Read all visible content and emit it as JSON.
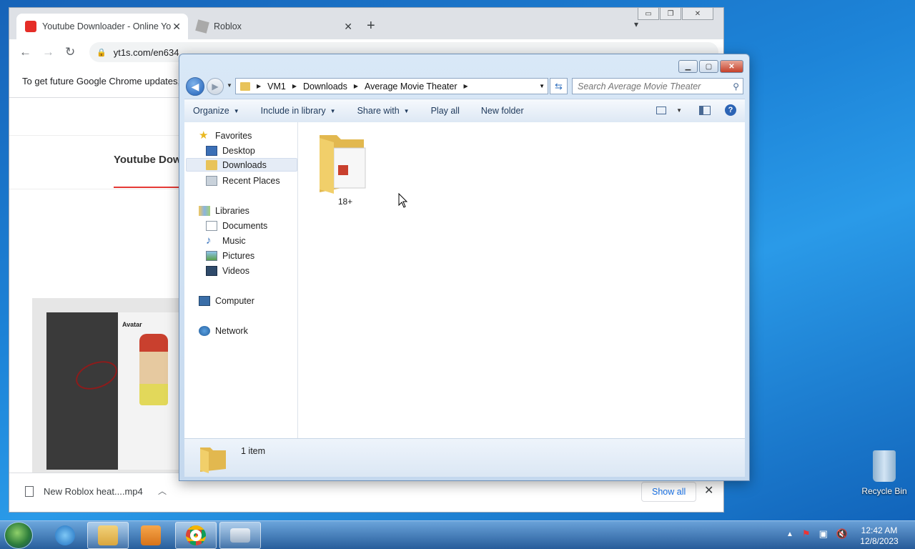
{
  "chrome": {
    "tabs": [
      {
        "label": "Youtube Downloader - Online Yo",
        "active": true
      },
      {
        "label": "Roblox",
        "active": false
      }
    ],
    "new_tab": "+",
    "tab_menu": "⌄",
    "url": "yt1s.com/en634",
    "infobar_text": "To get future Google Chrome updates,",
    "site_tab_text": "Youtube Dow",
    "thumb_avatar_label": "Avatar",
    "downloads": {
      "file_name": "New Roblox heat....mp4",
      "show_all": "Show all"
    }
  },
  "explorer": {
    "breadcrumbs": [
      "VM1",
      "Downloads",
      "Average Movie Theater"
    ],
    "search_placeholder": "Search Average Movie Theater",
    "commands": [
      {
        "label": "Organize",
        "dropdown": true
      },
      {
        "label": "Include in library",
        "dropdown": true
      },
      {
        "label": "Share with",
        "dropdown": true
      },
      {
        "label": "Play all",
        "dropdown": false
      },
      {
        "label": "New folder",
        "dropdown": false
      }
    ],
    "nav": {
      "favorites": "Favorites",
      "desktop": "Desktop",
      "downloads": "Downloads",
      "recent": "Recent Places",
      "libraries": "Libraries",
      "documents": "Documents",
      "music": "Music",
      "pictures": "Pictures",
      "videos": "Videos",
      "computer": "Computer",
      "network": "Network"
    },
    "items": [
      {
        "name": "18+"
      }
    ],
    "status_count": "1 item"
  },
  "desktop": {
    "recycle_bin": "Recycle Bin"
  },
  "taskbar": {
    "time": "12:42 AM",
    "date": "12/8/2023"
  }
}
